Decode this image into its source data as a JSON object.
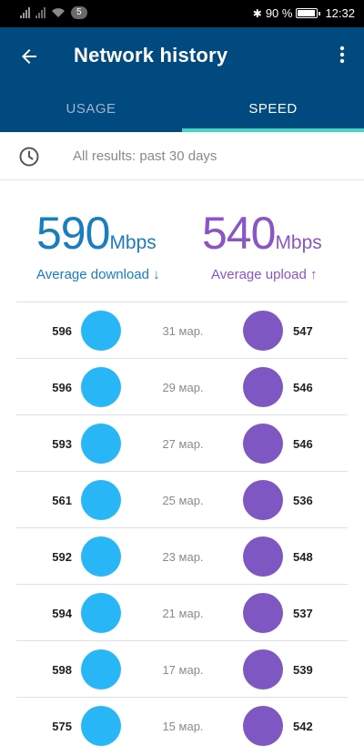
{
  "status_bar": {
    "badge": "5",
    "battery": "90 %",
    "time": "12:32"
  },
  "app_bar": {
    "title": "Network history"
  },
  "tabs": [
    {
      "label": "USAGE",
      "active": false
    },
    {
      "label": "SPEED",
      "active": true
    }
  ],
  "filter": {
    "text": "All results: past 30 days"
  },
  "summary": {
    "download": {
      "value": "590",
      "unit": "Mbps",
      "label": "Average download ↓"
    },
    "upload": {
      "value": "540",
      "unit": "Mbps",
      "label": "Average upload ↑"
    }
  },
  "colors": {
    "download": "#29b6f6",
    "upload": "#7e57c2",
    "app_bar": "#004a80",
    "tab_indicator": "#43d6c4"
  },
  "results": [
    {
      "download": "596",
      "date": "31 мар.",
      "upload": "547"
    },
    {
      "download": "596",
      "date": "29 мар.",
      "upload": "546"
    },
    {
      "download": "593",
      "date": "27 мар.",
      "upload": "546"
    },
    {
      "download": "561",
      "date": "25 мар.",
      "upload": "536"
    },
    {
      "download": "592",
      "date": "23 мар.",
      "upload": "548"
    },
    {
      "download": "594",
      "date": "21 мар.",
      "upload": "537"
    },
    {
      "download": "598",
      "date": "17 мар.",
      "upload": "539"
    },
    {
      "download": "575",
      "date": "15 мар.",
      "upload": "542"
    }
  ]
}
